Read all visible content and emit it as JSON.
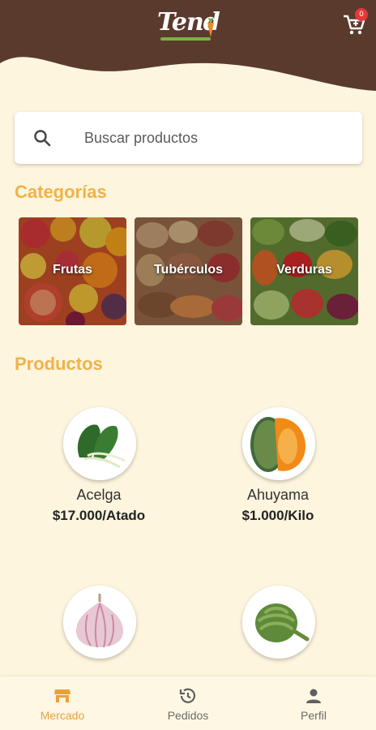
{
  "header": {
    "logo_text": "Tend",
    "cart_count": "0"
  },
  "search": {
    "placeholder": "Buscar productos"
  },
  "categories": {
    "title": "Categorías",
    "items": [
      {
        "label": "Frutas"
      },
      {
        "label": "Tubérculos"
      },
      {
        "label": "Verduras"
      }
    ]
  },
  "products": {
    "title": "Productos",
    "items": [
      {
        "name": "Acelga",
        "price": "$17.000/Atado"
      },
      {
        "name": "Ahuyama",
        "price": "$1.000/Kilo"
      },
      {
        "name": "",
        "price": ""
      },
      {
        "name": "",
        "price": ""
      }
    ]
  },
  "bottom_nav": {
    "items": [
      {
        "label": "Mercado",
        "icon": "store-icon",
        "active": true
      },
      {
        "label": "Pedidos",
        "icon": "history-icon",
        "active": false
      },
      {
        "label": "Perfil",
        "icon": "person-icon",
        "active": false
      }
    ]
  },
  "colors": {
    "brown": "#5b3a2e",
    "cream": "#fdf5de",
    "accent": "#f0b24a",
    "active_nav": "#e8a23c",
    "inactive_nav": "#6b6b6b"
  }
}
